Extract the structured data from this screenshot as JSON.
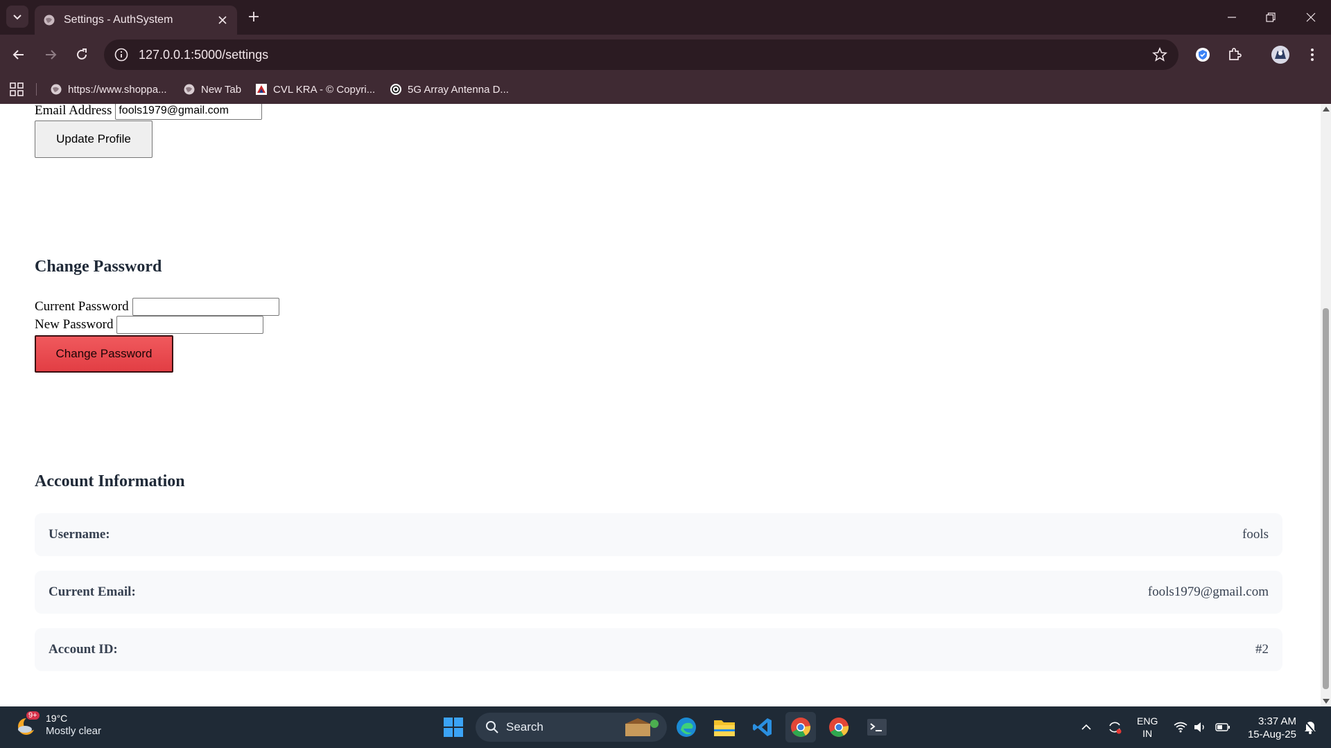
{
  "browser": {
    "tab_title": "Settings - AuthSystem",
    "url": "127.0.0.1:5000/settings",
    "bookmarks": [
      {
        "label": "https://www.shoppa..."
      },
      {
        "label": "New Tab"
      },
      {
        "label": "CVL KRA - © Copyri..."
      },
      {
        "label": "5G Array Antenna D..."
      }
    ]
  },
  "profile": {
    "email_label": "Email Address",
    "email_value": "fools1979@gmail.com",
    "update_button": "Update Profile"
  },
  "password": {
    "heading": "Change Password",
    "current_label": "Current Password",
    "new_label": "New Password",
    "current_value": "",
    "new_value": "",
    "change_button": "Change Password"
  },
  "account": {
    "heading": "Account Information",
    "rows": [
      {
        "key": "Username:",
        "value": "fools"
      },
      {
        "key": "Current Email:",
        "value": "fools1979@gmail.com"
      },
      {
        "key": "Account ID:",
        "value": "#2"
      }
    ]
  },
  "taskbar": {
    "weather_temp": "19°C",
    "weather_desc": "Mostly clear",
    "weather_badge": "9+",
    "search_label": "Search",
    "lang_top": "ENG",
    "lang_bottom": "IN",
    "time": "3:37 AM",
    "date": "15-Aug-25"
  },
  "colors": {
    "chrome_dark": "#2b1b22",
    "chrome_mid": "#3f2a33",
    "danger_button": "#e8484d",
    "info_row_bg": "#f8f9fb",
    "taskbar_bg": "#1f2a36"
  }
}
